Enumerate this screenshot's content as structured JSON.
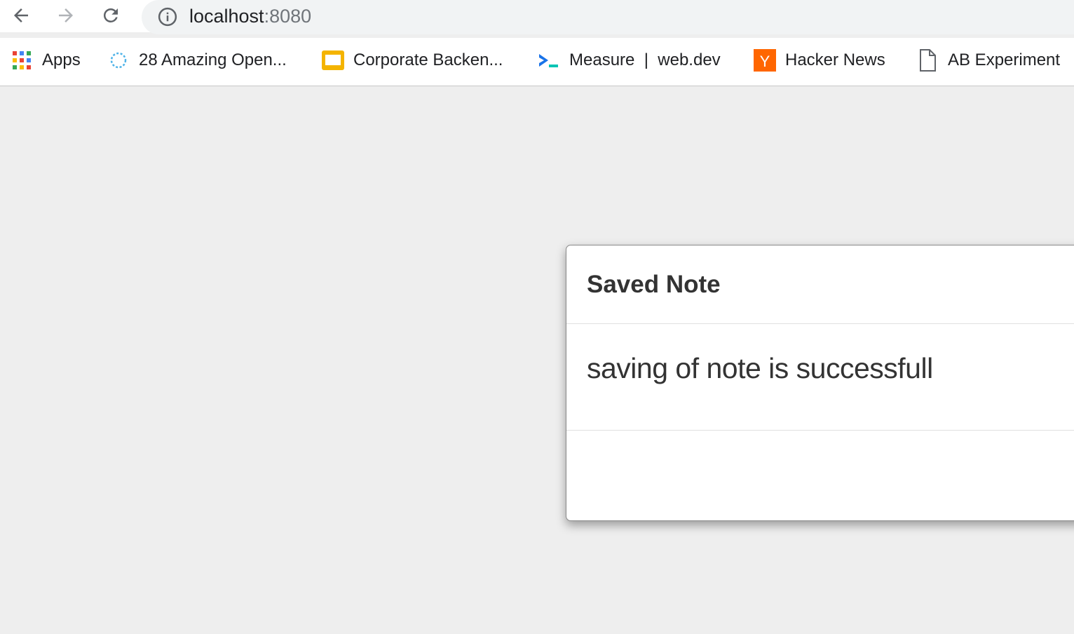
{
  "browser": {
    "url_host": "localhost",
    "url_port": ":8080",
    "back_icon": "arrow-left-icon",
    "forward_icon": "arrow-right-icon",
    "reload_icon": "reload-icon",
    "info_icon": "info-circle-icon"
  },
  "bookmarks": [
    {
      "label": "Apps",
      "icon": "apps-grid-icon"
    },
    {
      "label": "28 Amazing Open...",
      "icon": "dotted-circle-icon"
    },
    {
      "label": "Corporate Backen...",
      "icon": "slides-icon"
    },
    {
      "label": "Measure  |  web.dev",
      "icon": "webdev-icon"
    },
    {
      "label": "Hacker News",
      "icon": "hacker-news-icon"
    },
    {
      "label": "AB Experiment",
      "icon": "document-icon"
    }
  ],
  "modal": {
    "title": "Saved Note",
    "message": "saving of note is successfull"
  },
  "colors": {
    "page_background": "#eeeeee",
    "omnibox": "#f1f3f4",
    "hacker_news": "#ff6600",
    "slides": "#f4b400",
    "webdev": "#1a73e8"
  }
}
